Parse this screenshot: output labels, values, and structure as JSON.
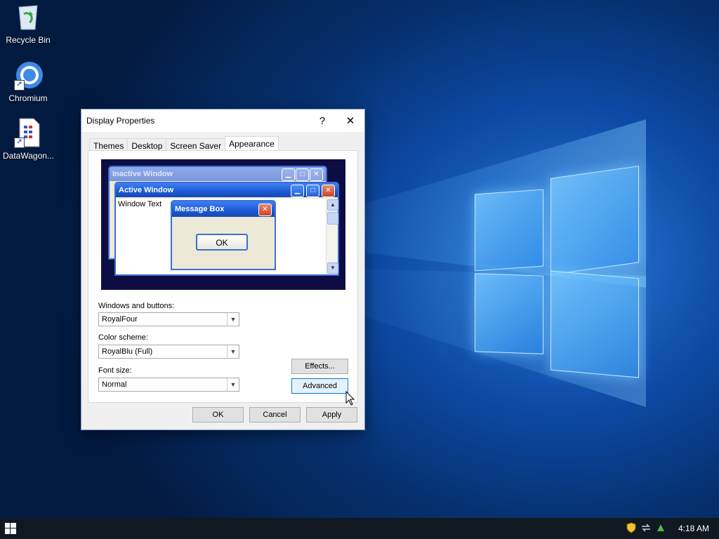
{
  "desktop": {
    "icons": [
      {
        "label": "Recycle Bin",
        "icon": "recycle-bin-icon"
      },
      {
        "label": "Chromium",
        "icon": "chromium-icon"
      },
      {
        "label": "DataWagon...",
        "icon": "datawagon-icon"
      }
    ]
  },
  "dialog": {
    "title": "Display Properties",
    "help_label": "?",
    "close_label": "✕",
    "tabs": [
      {
        "label": "Themes"
      },
      {
        "label": "Desktop"
      },
      {
        "label": "Screen Saver"
      },
      {
        "label": "Appearance",
        "active": true
      }
    ],
    "preview": {
      "inactive_title": "Inactive Window",
      "active_title": "Active Window",
      "window_text": "Window Text",
      "message_title": "Message Box",
      "ok_label": "OK"
    },
    "windows_buttons": {
      "label": "Windows and buttons:",
      "value": "RoyalFour"
    },
    "color_scheme": {
      "label": "Color scheme:",
      "value": "RoyalBlu (Full)"
    },
    "font_size": {
      "label": "Font size:",
      "value": "Normal"
    },
    "effects_label": "Effects...",
    "advanced_label": "Advanced",
    "ok_label": "OK",
    "cancel_label": "Cancel",
    "apply_label": "Apply"
  },
  "taskbar": {
    "time": "4:18 AM"
  }
}
